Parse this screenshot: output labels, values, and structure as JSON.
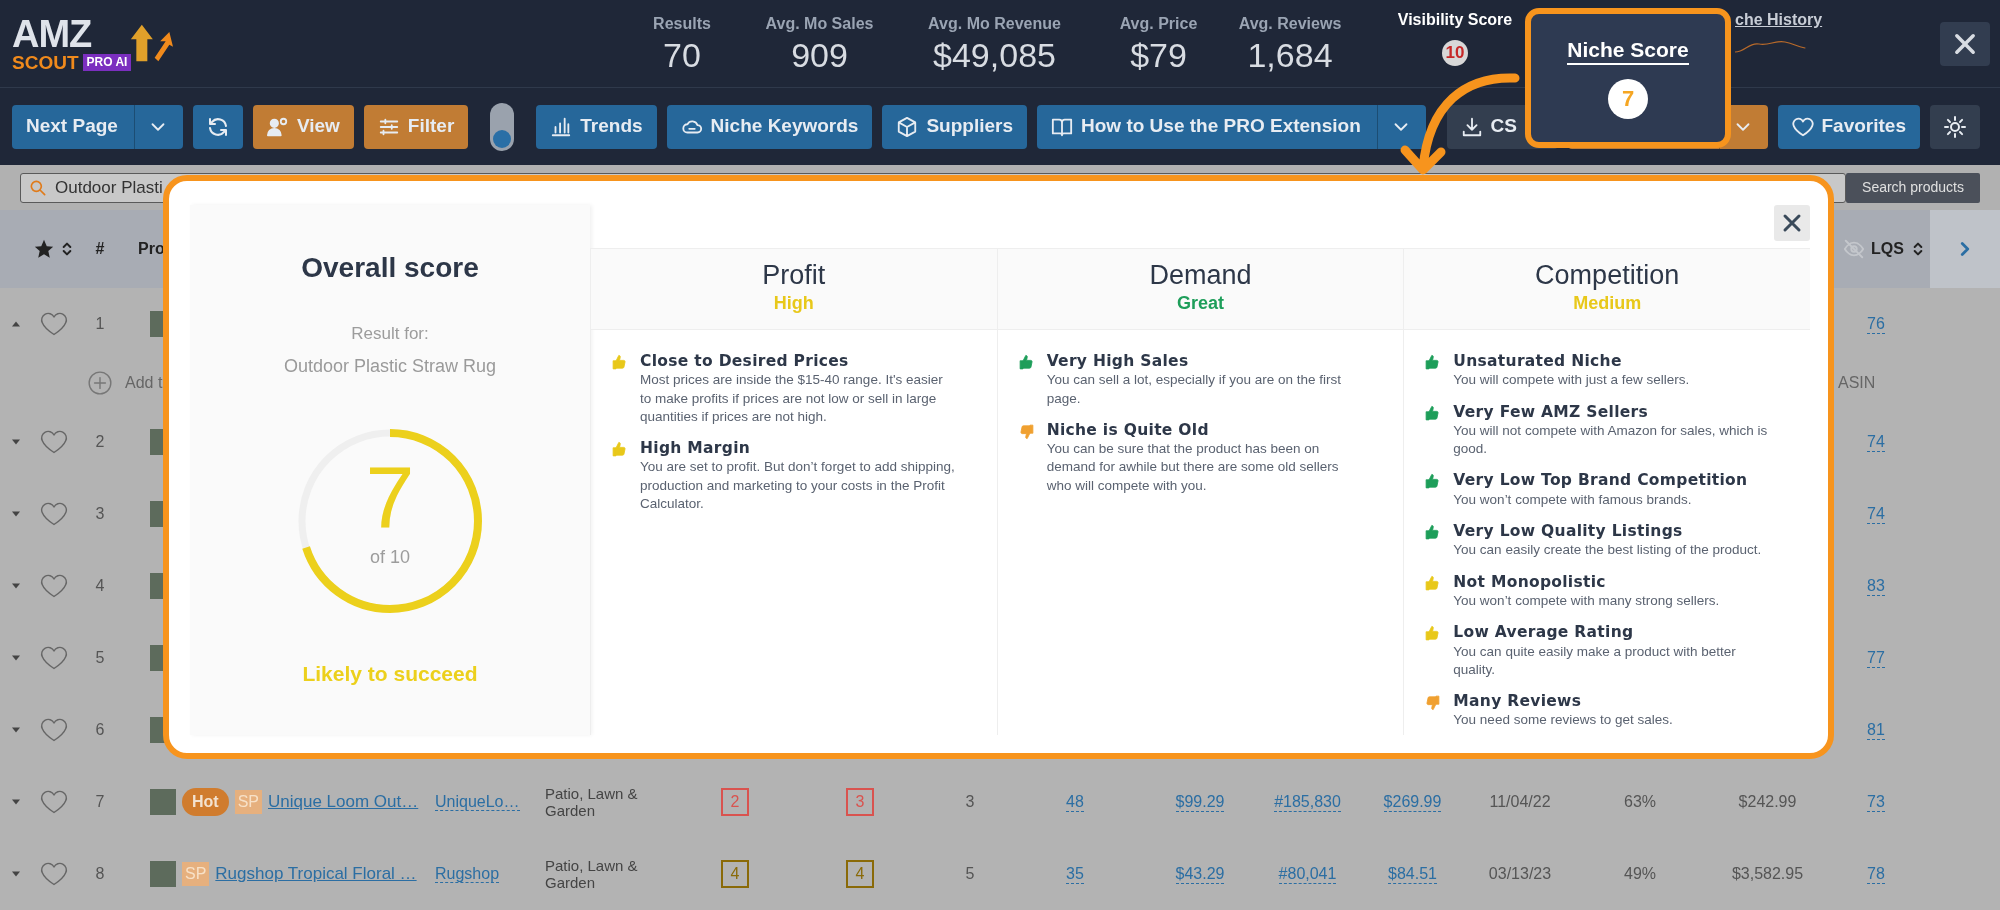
{
  "header": {
    "logo": {
      "word": "AMZ",
      "sub": "SCOUT",
      "badge": "PRO AI"
    },
    "stats": [
      {
        "label": "Results",
        "value": "70"
      },
      {
        "label": "Avg. Mo Sales",
        "value": "909"
      },
      {
        "label": "Avg. Mo Revenue",
        "value": "$49,085"
      },
      {
        "label": "Avg. Price",
        "value": "$79"
      },
      {
        "label": "Avg. Reviews",
        "value": "1,684"
      }
    ],
    "visibility": {
      "label": "Visibility Score",
      "value": "10"
    },
    "history": {
      "label": "che History"
    }
  },
  "toolbar": {
    "left": [
      {
        "kind": "split",
        "label": "Next Page"
      },
      {
        "kind": "icon"
      },
      {
        "kind": "button",
        "label": "View"
      },
      {
        "kind": "button",
        "label": "Filter"
      },
      {
        "kind": "toggle",
        "on": false
      },
      {
        "kind": "button",
        "label": "Trends"
      },
      {
        "kind": "button",
        "label": "Niche Keywords"
      },
      {
        "kind": "button",
        "label": "Suppliers"
      },
      {
        "kind": "split",
        "label": "How to Use the PRO Extension"
      }
    ],
    "right": [
      {
        "kind": "button",
        "label": "CS"
      },
      {
        "kind": "caret"
      },
      {
        "kind": "button",
        "label": "Favorites"
      },
      {
        "kind": "icon"
      }
    ]
  },
  "niche_score": {
    "title": "Niche Score",
    "value": "7"
  },
  "search": {
    "value": "Outdoor Plasti",
    "button": "Search products"
  },
  "table": {
    "header": {
      "num": "#",
      "product": "Pro",
      "lqs": "LQS"
    },
    "rows": [
      {
        "kind": "product",
        "expanded": true,
        "favorite": false,
        "num": "1",
        "lqs": "76"
      },
      {
        "kind": "add",
        "text": "Add t",
        "asin": "ASIN"
      },
      {
        "kind": "product",
        "expanded": false,
        "favorite": false,
        "num": "2",
        "lqs": "74"
      },
      {
        "kind": "product",
        "expanded": false,
        "favorite": false,
        "num": "3",
        "lqs": "74"
      },
      {
        "kind": "product",
        "expanded": false,
        "favorite": false,
        "num": "4",
        "lqs": "83"
      },
      {
        "kind": "product",
        "expanded": false,
        "favorite": false,
        "num": "5",
        "lqs": "77"
      },
      {
        "kind": "product",
        "expanded": false,
        "favorite": false,
        "num": "6",
        "lqs": "81"
      },
      {
        "kind": "product",
        "expanded": false,
        "favorite": false,
        "num": "7",
        "badges": [
          {
            "kind": "hot",
            "text": "Hot"
          },
          {
            "kind": "sp",
            "text": "SP"
          }
        ],
        "name": "Unique Loom Out…",
        "cells": [
          {
            "kind": "link",
            "text": "UniqueLo…"
          },
          {
            "kind": "text",
            "text": "Patio, Lawn & Garden"
          },
          {
            "kind": "score",
            "text": "2",
            "color": "#d9534f"
          },
          {
            "kind": "score",
            "text": "3",
            "color": "#d9534f"
          },
          {
            "kind": "text",
            "text": "3"
          },
          {
            "kind": "link",
            "text": "48"
          },
          {
            "kind": "link",
            "text": "$99.29"
          },
          {
            "kind": "link",
            "text": "#185,830"
          },
          {
            "kind": "link",
            "text": "$269.99"
          },
          {
            "kind": "text",
            "text": "11/04/22"
          },
          {
            "kind": "text",
            "text": "63%"
          },
          {
            "kind": "text",
            "text": "$242.99"
          }
        ],
        "lqs": "73"
      },
      {
        "kind": "product",
        "expanded": false,
        "favorite": false,
        "num": "8",
        "badges": [
          {
            "kind": "sp",
            "text": "SP"
          }
        ],
        "name": "Rugshop Tropical Floral …",
        "cells": [
          {
            "kind": "link",
            "text": "Rugshop"
          },
          {
            "kind": "text",
            "text": "Patio, Lawn & Garden"
          },
          {
            "kind": "score",
            "text": "4",
            "color": "#8a6a08"
          },
          {
            "kind": "score",
            "text": "4",
            "color": "#8a6a08"
          },
          {
            "kind": "text",
            "text": "5"
          },
          {
            "kind": "link",
            "text": "35"
          },
          {
            "kind": "link",
            "text": "$43.29"
          },
          {
            "kind": "link",
            "text": "#80,041"
          },
          {
            "kind": "link",
            "text": "$84.51"
          },
          {
            "kind": "text",
            "text": "03/13/23"
          },
          {
            "kind": "text",
            "text": "49%"
          },
          {
            "kind": "text",
            "text": "$3,582.95"
          }
        ],
        "lqs": "78"
      }
    ]
  },
  "modal": {
    "overall": {
      "title": "Overall score",
      "result_label": "Result for:",
      "query": "Outdoor Plastic Straw Rug",
      "score": "7",
      "of": "of 10",
      "level": 0.7,
      "verdict": "Likely to succeed"
    },
    "categories": [
      {
        "title": "Profit",
        "rating": "High",
        "color": "#e8c81a",
        "items": [
          {
            "kind": "up",
            "color": "#e8c81a",
            "title": "Close to Desired Prices",
            "text": "Most prices are inside the $15-40 range. It's easier to make profits if prices are not low or sell in large quantities if prices are not high."
          },
          {
            "kind": "up",
            "color": "#e8c81a",
            "title": "High Margin",
            "text": "You are set to profit. But don’t forget to add shipping, production and marketing to your costs in the Profit Calculator."
          }
        ]
      },
      {
        "title": "Demand",
        "rating": "Great",
        "color": "#1e9e5a",
        "items": [
          {
            "kind": "up",
            "color": "#1e9e5a",
            "title": "Very High Sales",
            "text": "You can sell a lot, especially if you are on the first page."
          },
          {
            "kind": "down",
            "color": "#f0a030",
            "title": "Niche is Quite Old",
            "text": "You can be sure that the product has been on demand for awhile but there are some old sellers who will compete with you."
          }
        ]
      },
      {
        "title": "Competition",
        "rating": "Medium",
        "color": "#e8c81a",
        "items": [
          {
            "kind": "up",
            "color": "#1e9e5a",
            "title": "Unsaturated Niche",
            "text": "You will compete with just a few sellers."
          },
          {
            "kind": "up",
            "color": "#1e9e5a",
            "title": "Very Few AMZ Sellers",
            "text": "You will not compete with Amazon for sales, which is good."
          },
          {
            "kind": "up",
            "color": "#1e9e5a",
            "title": "Very Low Top Brand Competition",
            "text": "You won’t compete with famous brands."
          },
          {
            "kind": "up",
            "color": "#1e9e5a",
            "title": "Very Low Quality Listings",
            "text": "You can easily create the best listing of the product."
          },
          {
            "kind": "up",
            "color": "#e8c81a",
            "title": "Not Monopolistic",
            "text": "You won’t compete with many strong sellers."
          },
          {
            "kind": "up",
            "color": "#e8c81a",
            "title": "Low Average Rating",
            "text": "You can quite easily make a product with better quality."
          },
          {
            "kind": "down",
            "color": "#f0a030",
            "title": "Many Reviews",
            "text": "You need some reviews to get sales."
          }
        ]
      }
    ]
  }
}
